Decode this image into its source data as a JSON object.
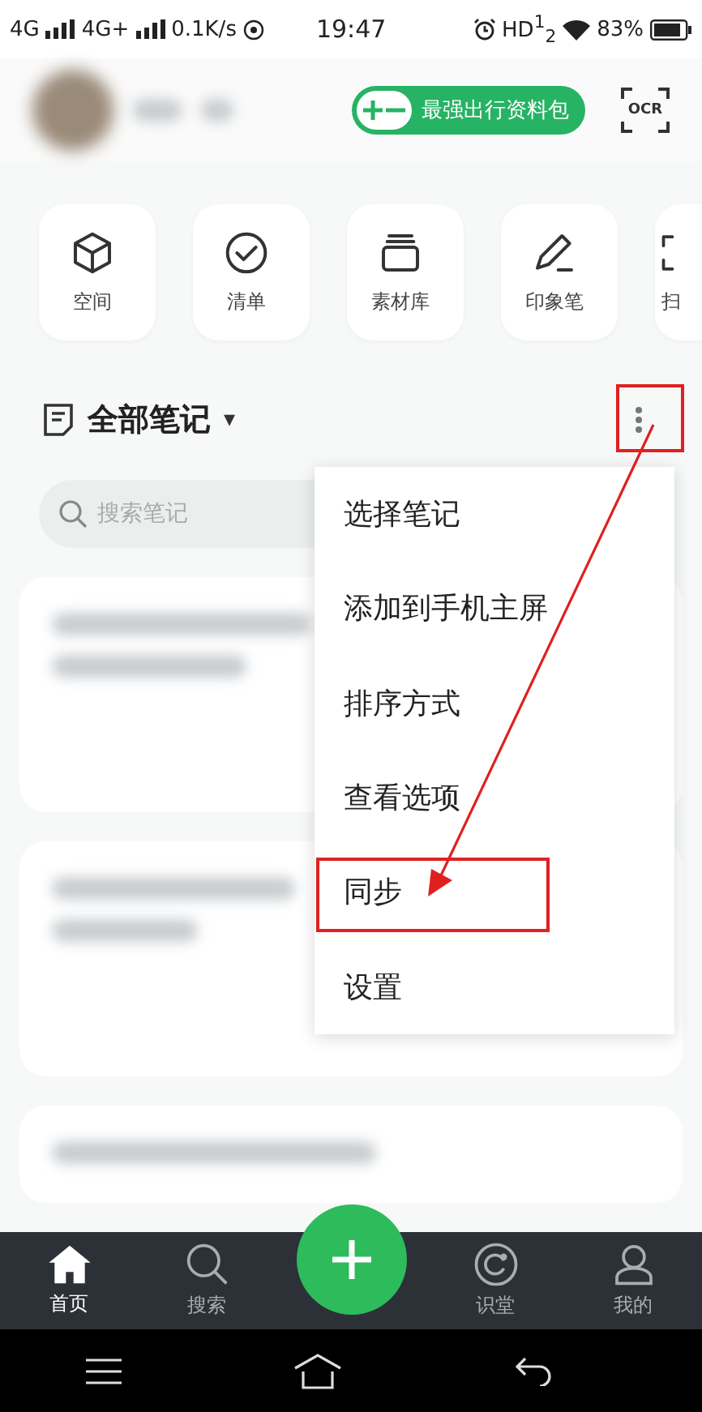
{
  "status_bar": {
    "network_1": "4G",
    "network_2": "4G+",
    "speed": "0.1K/s",
    "time": "19:47",
    "hd": "HD$^{1}$$_{2}$",
    "battery": "83%"
  },
  "header": {
    "promo_button": "最强出行资料包",
    "ocr_button": "OCR"
  },
  "shortcuts": [
    {
      "kind": "cube",
      "label": "空间"
    },
    {
      "kind": "check",
      "label": "清单"
    },
    {
      "kind": "stack",
      "label": "素材库"
    },
    {
      "kind": "pen",
      "label": "印象笔"
    },
    {
      "kind": "scan",
      "label": "扫"
    }
  ],
  "notes_header": {
    "title": "全部笔记",
    "caret": "▾"
  },
  "search": {
    "placeholder": "搜索笔记"
  },
  "menu": {
    "items": [
      "选择笔记",
      "添加到手机主屏",
      "排序方式",
      "查看选项",
      "同步",
      "设置"
    ]
  },
  "tab_bar": {
    "items": [
      {
        "kind": "home",
        "label": "首页",
        "selected": true
      },
      {
        "kind": "search",
        "label": "搜索",
        "selected": false
      },
      {
        "kind": "add",
        "selected": false
      },
      {
        "kind": "discover",
        "label": "识堂",
        "selected": false
      },
      {
        "kind": "profile",
        "label": "我的",
        "selected": false
      }
    ]
  }
}
